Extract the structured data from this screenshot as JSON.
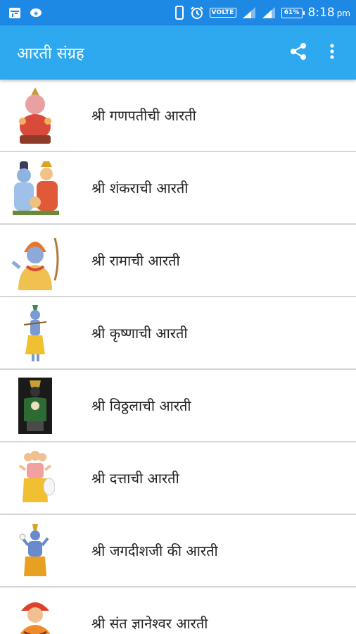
{
  "status_bar": {
    "volte": "VOLTE",
    "battery": "61%",
    "time": "8:18",
    "ampm": "pm",
    "icons": [
      "notification-app-icon",
      "notification-icon",
      "vibrate-icon",
      "alarm-icon",
      "signal-icon",
      "signal-icon-2",
      "battery-icon"
    ]
  },
  "app_bar": {
    "title": "आरती संग्रह",
    "actions": [
      "share-icon",
      "more-vert-icon"
    ],
    "color": "#2ea8ee"
  },
  "list": {
    "items": [
      {
        "label": "श्री गणपतीची आरती",
        "icon": "ganpati-image"
      },
      {
        "label": "श्री शंकराची आरती",
        "icon": "shankar-image"
      },
      {
        "label": "श्री रामाची आरती",
        "icon": "ram-image"
      },
      {
        "label": "श्री कृष्णाची आरती",
        "icon": "krishna-image"
      },
      {
        "label": "श्री विठ्ठलाची आरती",
        "icon": "vitthal-image"
      },
      {
        "label": "श्री दत्ताची आरती",
        "icon": "datta-image"
      },
      {
        "label": "श्री जगदीशजी की आरती",
        "icon": "jagdish-image"
      },
      {
        "label": "श्री संत ज्ञानेश्वर आरती",
        "icon": "dnyaneshwar-image"
      }
    ]
  }
}
